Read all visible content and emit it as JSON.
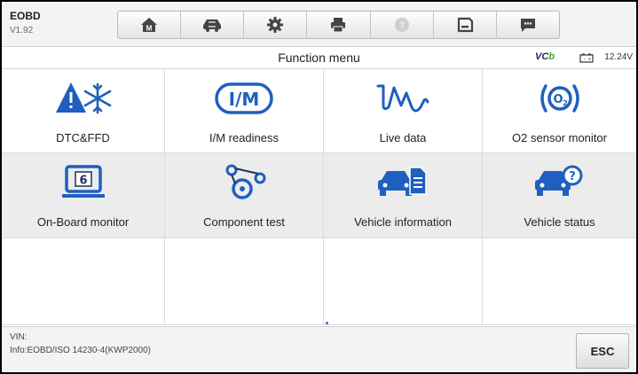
{
  "app": {
    "name": "EOBD",
    "version": "V1.92"
  },
  "toolbar": {
    "buttons": [
      {
        "icon": "home-icon",
        "letter": "M"
      },
      {
        "icon": "vehicle-swap-icon"
      },
      {
        "icon": "settings-gear-icon"
      },
      {
        "icon": "print-icon"
      },
      {
        "icon": "help-icon"
      },
      {
        "icon": "save-icon"
      },
      {
        "icon": "message-icon"
      }
    ]
  },
  "titlebar": {
    "title": "Function menu",
    "vci_label": "VC",
    "vci_accent": "b",
    "voltage": "12.24V"
  },
  "menu": {
    "items": [
      {
        "label": "DTC&FFD",
        "icon": "dtc-warning-snowflake-icon"
      },
      {
        "label": "I/M readiness",
        "icon": "im-readiness-icon"
      },
      {
        "label": "Live data",
        "icon": "live-data-graph-icon"
      },
      {
        "label": "O2 sensor monitor",
        "icon": "o2-sensor-icon"
      },
      {
        "label": "On-Board monitor",
        "icon": "onboard-monitor-icon",
        "badge": "6"
      },
      {
        "label": "Component test",
        "icon": "component-test-belt-icon"
      },
      {
        "label": "Vehicle information",
        "icon": "vehicle-information-icon"
      },
      {
        "label": "Vehicle status",
        "icon": "vehicle-status-icon"
      }
    ]
  },
  "footer": {
    "vin_label": "VIN:",
    "info": "Info:EOBD/ISO 14230-4(KWP2000)",
    "esc_label": "ESC"
  },
  "colors": {
    "accent_blue": "#1f5fbf",
    "icon_dark": "#20305a",
    "battery_green": "#3cab2e"
  }
}
